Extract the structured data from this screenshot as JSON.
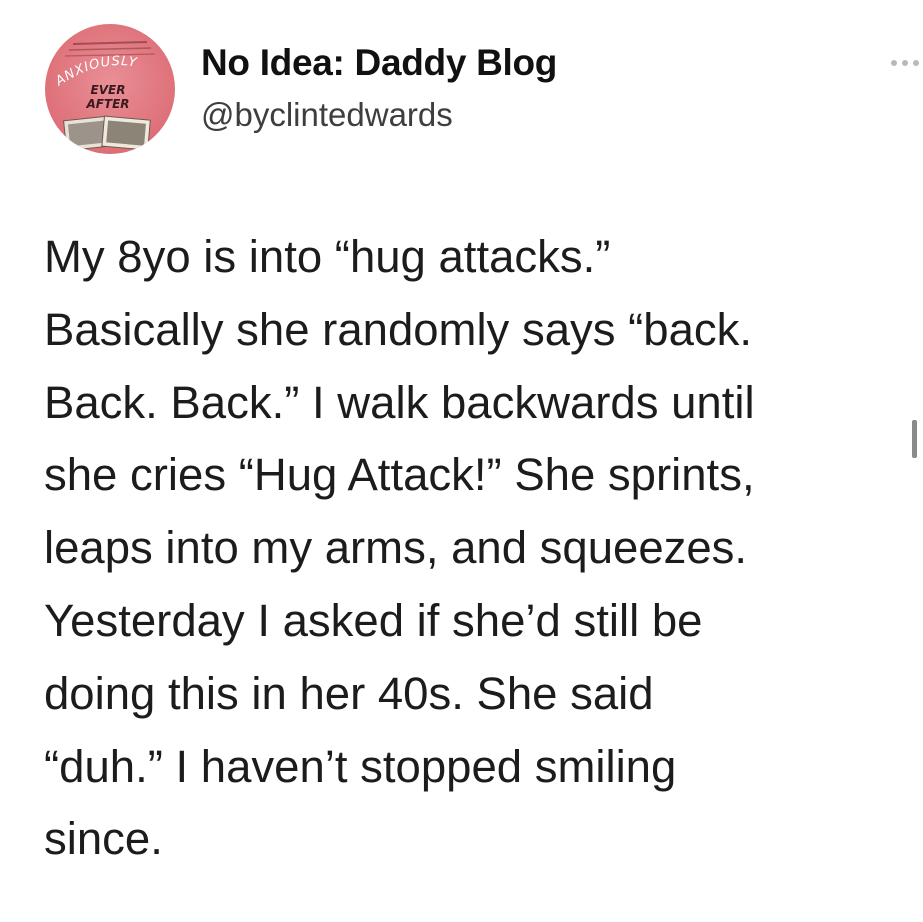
{
  "tweet": {
    "author": {
      "display_name": "No Idea: Daddy Blog",
      "handle": "@byclintedwards",
      "avatar": {
        "icon": "book-cover-avatar",
        "cover_text_top": "ANXIOUSLY",
        "cover_text_mid": "EVER",
        "cover_text_bottom": "AFTER"
      }
    },
    "more_icon": "more-dots-icon",
    "text_lines": [
      "My 8yo is into “hug attacks.”",
      "Basically she randomly says “back.",
      "Back. Back.” I walk backwards until",
      "she cries “Hug Attack!” She sprints,",
      "leaps into my arms, and squeezes.",
      "Yesterday I asked if she’d still be",
      "doing this in her 40s. She said",
      "“duh.” I haven’t stopped smiling",
      "since."
    ]
  },
  "colors": {
    "avatar_bg": "#de7078",
    "text": "#1c1c1c",
    "handle": "#3e3e3e"
  }
}
